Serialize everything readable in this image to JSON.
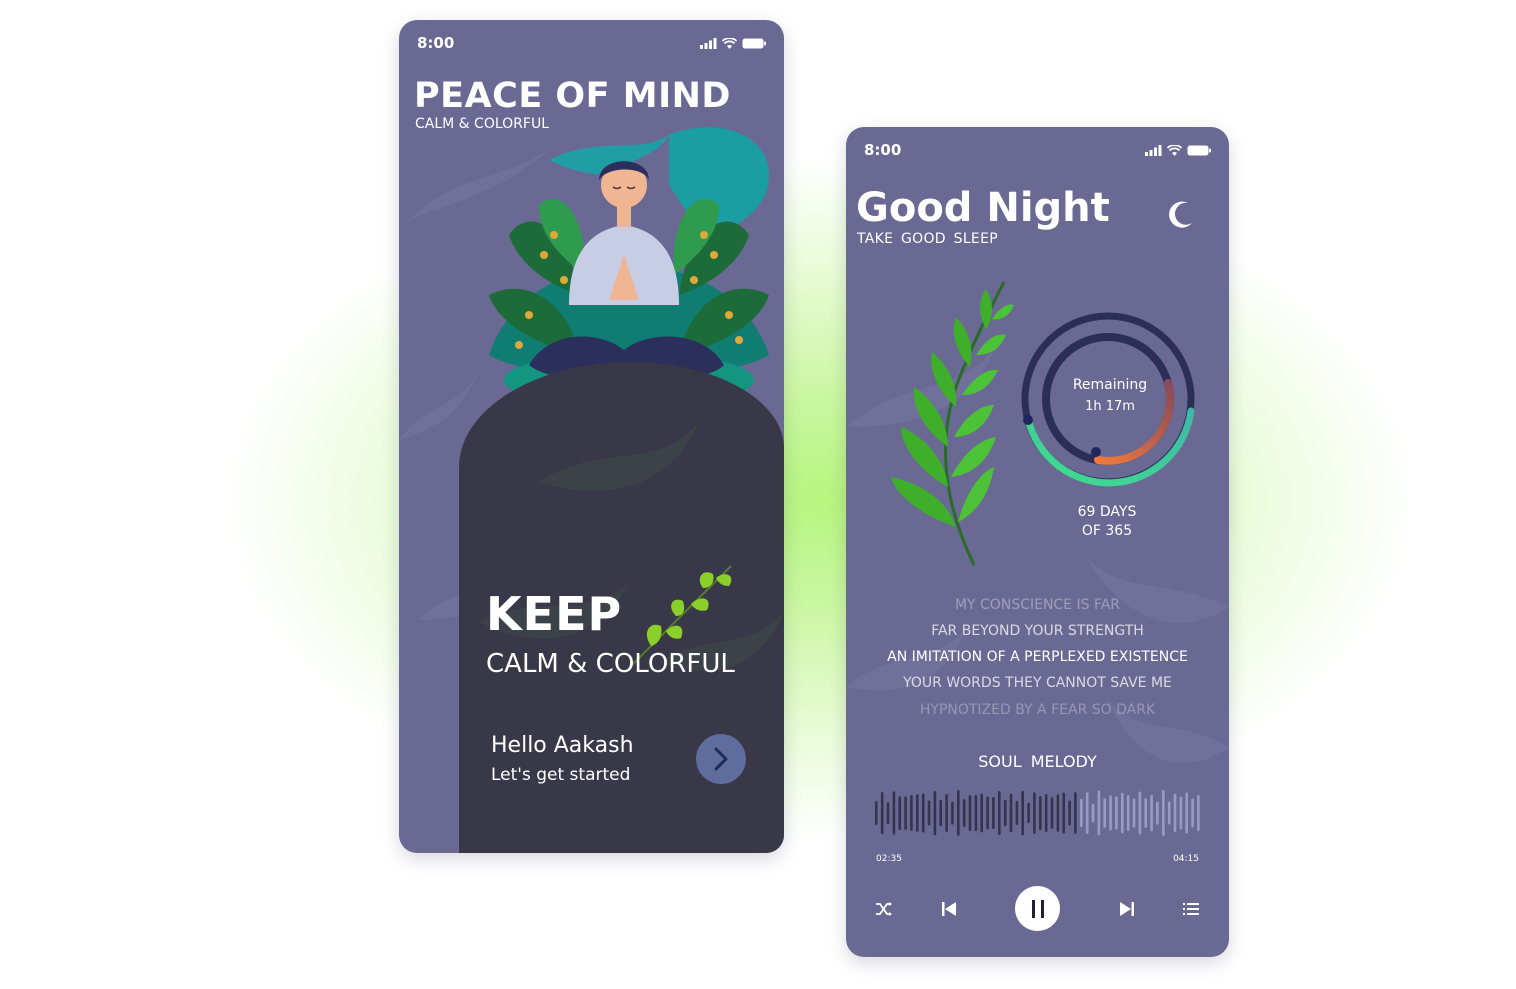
{
  "screen1": {
    "status_time": "8:00",
    "title": "PEACE OF MIND",
    "subtitle": "CALM & COLORFUL",
    "headline": "KEEP",
    "headline_sub": "CALM & COLORFUL",
    "greeting": "Hello Aakash",
    "cta_text": "Let's get started",
    "next_icon": "chevron-right-icon"
  },
  "screen2": {
    "status_time": "8:00",
    "title": "Good Night",
    "subtitle": "TAKE GOOD SLEEP",
    "moon_icon": "moon-icon",
    "remaining_label": "Remaining",
    "remaining_value": "1h 17m",
    "remaining_progress": 0.6,
    "days_line1": "69 DAYS",
    "days_line2": "OF 365",
    "lyrics": [
      "MY CONSCIENCE IS FAR",
      "FAR BEYOND YOUR STRENGTH",
      "AN IMITATION OF A PERPLEXED EXISTENCE",
      "YOUR WORDS THEY CANNOT SAVE ME",
      "HYPNOTIZED BY A FEAR SO DARK"
    ],
    "song_title": "SOUL  MELODY",
    "time_elapsed": "02:35",
    "time_total": "04:15",
    "playback_progress": 0.61,
    "controls": [
      "shuffle-icon",
      "previous-icon",
      "pause-icon",
      "next-icon",
      "playlist-icon"
    ]
  },
  "colors": {
    "phone_bg": "#696993",
    "dark_panel": "#383848",
    "accent_green": "#3fe08c",
    "accent_orange": "#e8744a",
    "button_blue": "#5e6c9e"
  }
}
